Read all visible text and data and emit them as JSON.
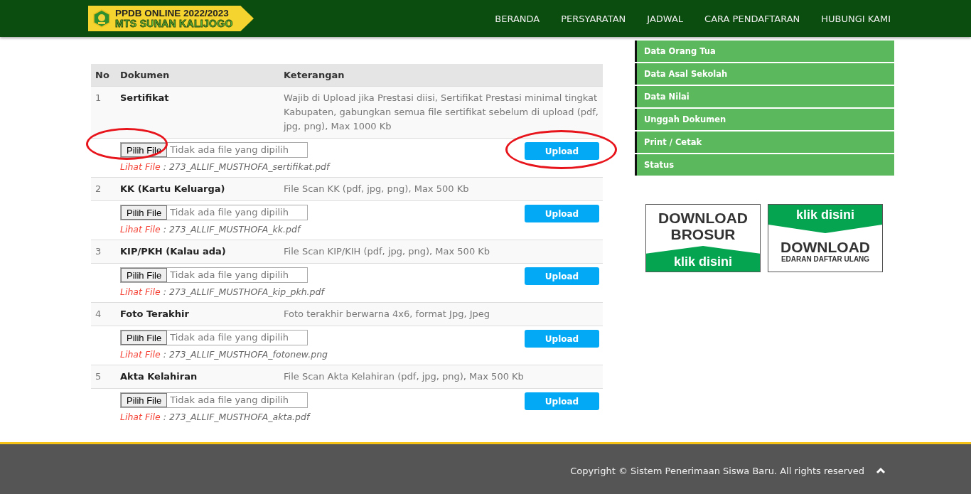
{
  "header": {
    "logo": {
      "line_1": "PPDB ONLINE 2022/2023",
      "line_2": "MTS SUNAN KALIJOGO"
    },
    "nav": [
      "BERANDA",
      "PERSYARATAN",
      "JADWAL",
      "CARA PENDAFTARAN",
      "HUBUNGI KAMI"
    ]
  },
  "table": {
    "columns": [
      "No",
      "Dokumen",
      "Keterangan"
    ],
    "rows": [
      {
        "no": "1",
        "document": "Sertifikat",
        "description": "Wajib di Upload jika Prestasi diisi, Sertifikat Prestasi minimal tingkat Kabupaten, gabungkan semua file sertifikat sebelum di upload (pdf, jpg, png), Max 1000 Kb",
        "file_button": "Pilih File",
        "file_status": "Tidak ada file yang dipilih",
        "upload_button": "Upload",
        "view_label": "Lihat File",
        "view_file": " : 273_ALLIF_MUSTHOFA_sertifikat.pdf"
      },
      {
        "no": "2",
        "document": "KK (Kartu Keluarga)",
        "description": "File Scan KK (pdf, jpg, png), Max 500 Kb",
        "file_button": "Pilih File",
        "file_status": "Tidak ada file yang dipilih",
        "upload_button": "Upload",
        "view_label": "Lihat File",
        "view_file": " : 273_ALLIF_MUSTHOFA_kk.pdf"
      },
      {
        "no": "3",
        "document": "KIP/PKH (Kalau ada)",
        "description": "File Scan KIP/KIH (pdf, jpg, png), Max 500 Kb",
        "file_button": "Pilih File",
        "file_status": "Tidak ada file yang dipilih",
        "upload_button": "Upload",
        "view_label": "Lihat File",
        "view_file": " : 273_ALLIF_MUSTHOFA_kip_pkh.pdf"
      },
      {
        "no": "4",
        "document": "Foto Terakhir",
        "description": "Foto terakhir berwarna 4x6, format Jpg, Jpeg",
        "file_button": "Pilih File",
        "file_status": "Tidak ada file yang dipilih",
        "upload_button": "Upload",
        "view_label": "Lihat File",
        "view_file": " : 273_ALLIF_MUSTHOFA_fotonew.png"
      },
      {
        "no": "5",
        "document": "Akta Kelahiran",
        "description": "File Scan Akta Kelahiran (pdf, jpg, png), Max 500 Kb",
        "file_button": "Pilih File",
        "file_status": "Tidak ada file yang dipilih",
        "upload_button": "Upload",
        "view_label": "Lihat File",
        "view_file": " : 273_ALLIF_MUSTHOFA_akta.pdf"
      }
    ]
  },
  "sidebar": {
    "items": [
      "Data Orang Tua",
      "Data Asal Sekolah",
      "Data Nilai",
      "Unggah Dokumen",
      "Print / Cetak",
      "Status"
    ]
  },
  "banners": [
    {
      "kind": "ribbon_bottom",
      "title": "DOWNLOAD",
      "title_2": "BROSUR",
      "ribbon": "klik disini"
    },
    {
      "kind": "ribbon_top",
      "ribbon": "klik disini",
      "title": "DOWNLOAD",
      "title_2": "EDARAN DAFTAR ULANG"
    }
  ],
  "footer": {
    "copyright": "Copyright © Sistem Penerimaan Siswa Baru. All rights reserved"
  }
}
